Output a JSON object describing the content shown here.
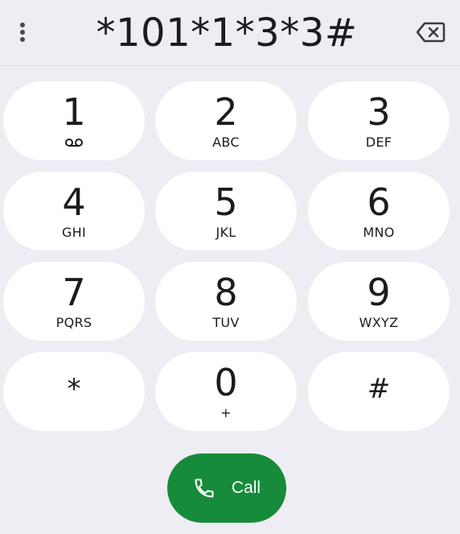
{
  "dialer": {
    "number": "*101*1*3*3#"
  },
  "keys": [
    {
      "digit": "1",
      "letters": ""
    },
    {
      "digit": "2",
      "letters": "ABC"
    },
    {
      "digit": "3",
      "letters": "DEF"
    },
    {
      "digit": "4",
      "letters": "GHI"
    },
    {
      "digit": "5",
      "letters": "JKL"
    },
    {
      "digit": "6",
      "letters": "MNO"
    },
    {
      "digit": "7",
      "letters": "PQRS"
    },
    {
      "digit": "8",
      "letters": "TUV"
    },
    {
      "digit": "9",
      "letters": "WXYZ"
    },
    {
      "digit": "*",
      "letters": ""
    },
    {
      "digit": "0",
      "letters": "+"
    },
    {
      "digit": "#",
      "letters": ""
    }
  ],
  "call": {
    "label": "Call"
  },
  "icons": {
    "menu": "more-vert-icon",
    "backspace": "backspace-icon",
    "voicemail": "voicemail-icon",
    "call": "phone-icon"
  },
  "colors": {
    "background": "#eeedf4",
    "key": "#ffffff",
    "call": "#168c3a",
    "text": "#1d1b20"
  }
}
